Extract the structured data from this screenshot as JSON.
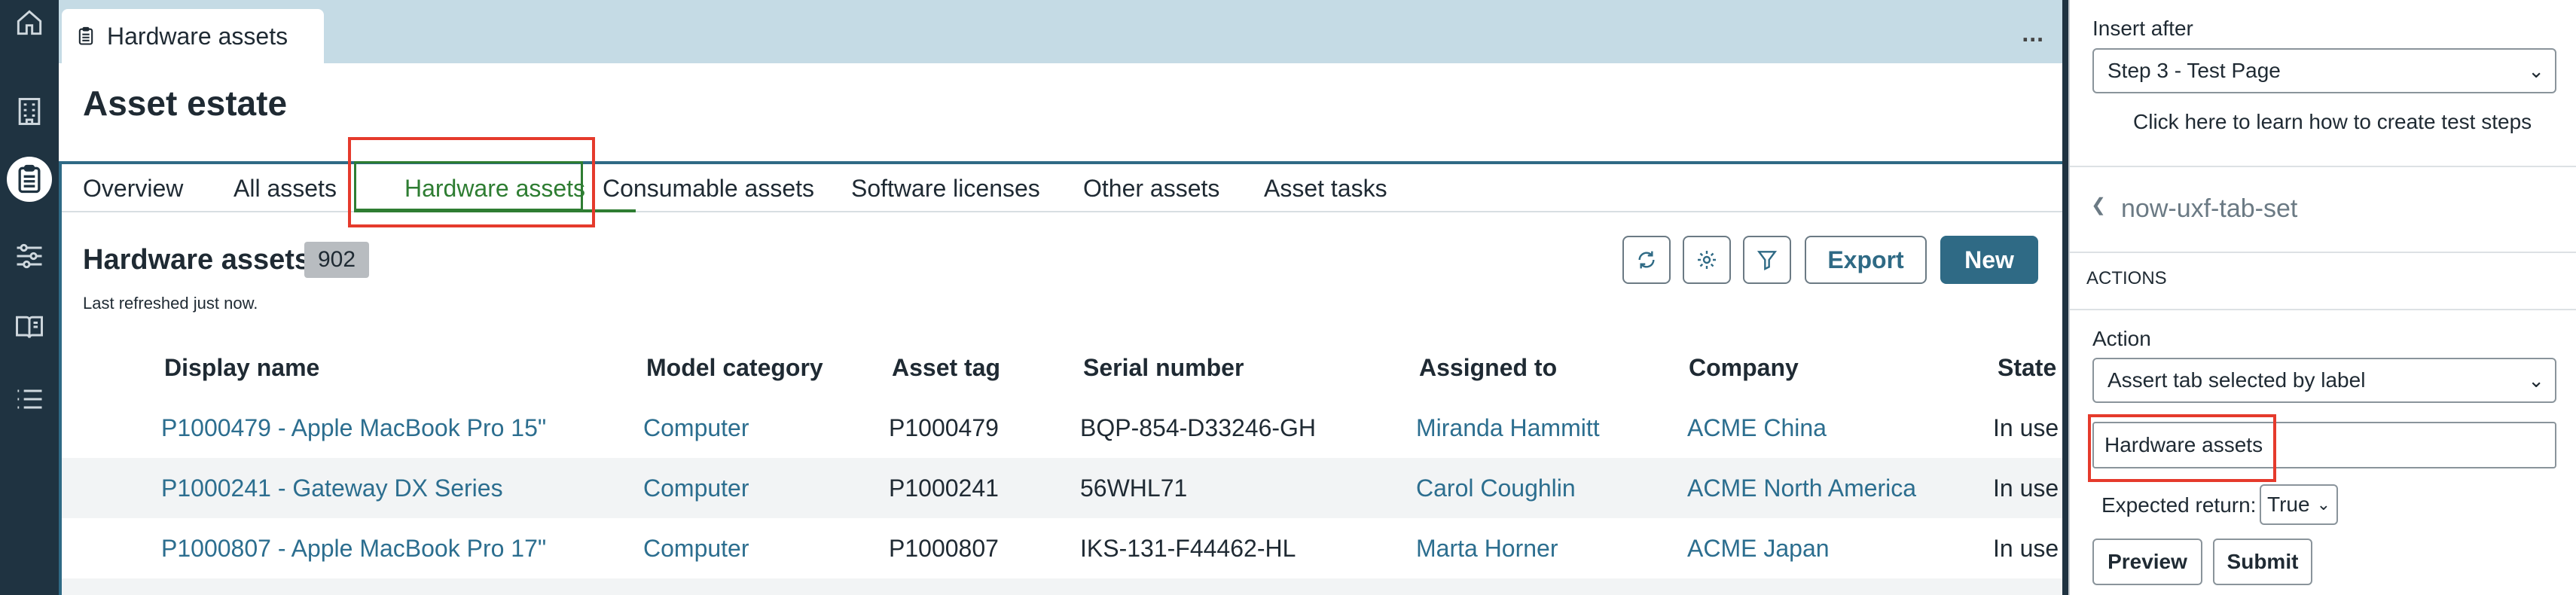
{
  "doc_tab": {
    "label": "Hardware assets",
    "more": "..."
  },
  "page": {
    "title": "Asset estate"
  },
  "tabs": [
    {
      "label": "Overview"
    },
    {
      "label": "All assets"
    },
    {
      "label": "Hardware assets",
      "selected": true
    },
    {
      "label": "Consumable assets"
    },
    {
      "label": "Software licenses"
    },
    {
      "label": "Other assets"
    },
    {
      "label": "Asset tasks"
    }
  ],
  "list": {
    "title": "Hardware assets",
    "count": "902",
    "refresh_note": "Last refreshed just now.",
    "export_label": "Export",
    "new_label": "New",
    "columns": [
      "Display name",
      "Model category",
      "Asset tag",
      "Serial number",
      "Assigned to",
      "Company",
      "State"
    ],
    "rows": [
      {
        "display_name": "P1000479 - Apple MacBook Pro 15\"",
        "model_category": "Computer",
        "asset_tag": "P1000479",
        "serial": "BQP-854-D33246-GH",
        "assigned_to": "Miranda Hammitt",
        "company": "ACME China",
        "state": "In use"
      },
      {
        "display_name": "P1000241 - Gateway DX Series",
        "model_category": "Computer",
        "asset_tag": "P1000241",
        "serial": "56WHL71",
        "assigned_to": "Carol Coughlin",
        "company": "ACME North America",
        "state": "In use"
      },
      {
        "display_name": "P1000807 - Apple MacBook Pro 17\"",
        "model_category": "Computer",
        "asset_tag": "P1000807",
        "serial": "IKS-131-F44462-HL",
        "assigned_to": "Marta Horner",
        "company": "ACME Japan",
        "state": "In use"
      }
    ]
  },
  "panel": {
    "insert_after_label": "Insert after",
    "insert_after_value": "Step 3 - Test Page",
    "learn_link": "Click here to learn how to create test steps",
    "component_name": "now-uxf-tab-set",
    "actions_heading": "ACTIONS",
    "action_label": "Action",
    "action_value": "Assert tab selected by label",
    "tab_label_value": "Hardware assets",
    "expected_return_label": "Expected return:",
    "expected_return_value": "True",
    "preview_label": "Preview",
    "submit_label": "Submit"
  },
  "colors": {
    "rail": "#1f3341",
    "accent": "#2f6a85",
    "selected_tab": "#2e7d32",
    "highlight": "#e53a2c",
    "link": "#2c6e8f"
  }
}
